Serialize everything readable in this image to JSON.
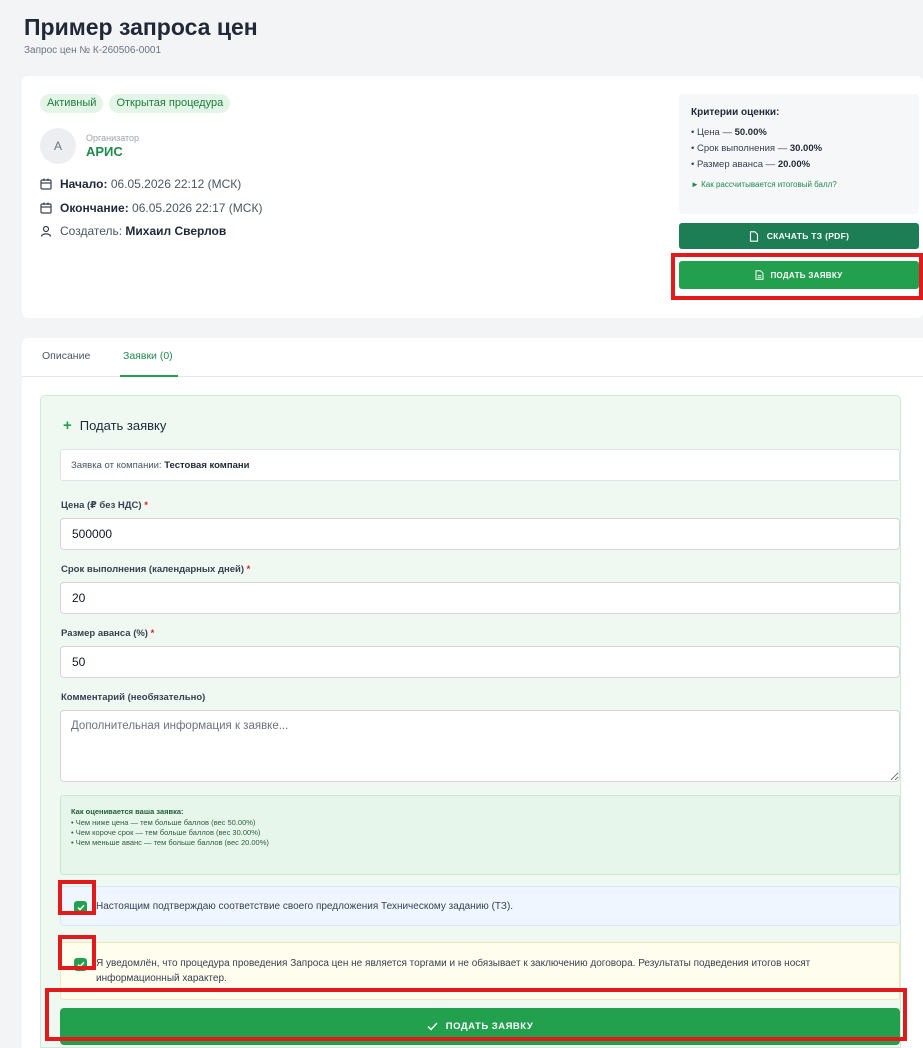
{
  "page": {
    "title": "Пример запроса цен",
    "subtitle": "Запрос цен № К-260506-0001"
  },
  "summary": {
    "badges": [
      "Активный",
      "Открытая процедура"
    ],
    "organizer": {
      "avatar_letter": "А",
      "label": "Организатор",
      "name": "АРИС"
    },
    "start": {
      "label": "Начало:",
      "value": " 06.05.2026 22:12 (МСК)"
    },
    "end": {
      "label": "Окончание:",
      "value": " 06.05.2026 22:17 (МСК)"
    },
    "creator": {
      "label": "Создатель: ",
      "value": "Михаил Сверлов"
    },
    "criteria": {
      "title": "Критерии оценки:",
      "items": [
        {
          "name": "• Цена — ",
          "value": "50.00%"
        },
        {
          "name": "• Срок выполнения — ",
          "value": "30.00%"
        },
        {
          "name": "• Размер аванса — ",
          "value": "20.00%"
        }
      ],
      "link": "► Как рассчитывается итоговый балл?"
    },
    "download_label": "СКАЧАТЬ ТЗ (PDF)",
    "submit_top_label": "ПОДАТЬ ЗАЯВКУ"
  },
  "tabs": [
    {
      "label": "Описание",
      "active": false
    },
    {
      "label": "Заявки (0)",
      "active": true
    }
  ],
  "form": {
    "title": "Подать заявку",
    "company_label": "Заявка от компании: ",
    "company_name": "Тестовая компани",
    "price": {
      "label": "Цена (₽ без НДС)",
      "required": " *",
      "value": "500000"
    },
    "duration": {
      "label": "Срок выполнения (календарных дней)",
      "required": " *",
      "value": "20"
    },
    "advance": {
      "label": "Размер аванса (%)",
      "required": " *",
      "value": "50"
    },
    "comment": {
      "label": "Комментарий (необязательно)",
      "placeholder": "Дополнительная информация к заявке...",
      "value": ""
    },
    "scoring": {
      "title": "Как оценивается ваша заявка:",
      "items": [
        "• Чем ниже цена — тем больше баллов (вес 50.00%)",
        "• Чем короче срок — тем больше баллов (вес 30.00%)",
        "• Чем меньше аванс — тем больше баллов (вес 20.00%)"
      ]
    },
    "confirm_tz": {
      "text": "Настоящим подтверждаю соответствие своего предложения Техническому заданию (ТЗ).",
      "checked": true
    },
    "confirm_notice": {
      "text": "Я уведомлён, что процедура проведения Запроса цен не является торгами и не обязывает к заключению договора. Результаты подведения итогов носят информационный характер.",
      "checked": true
    },
    "submit_label": "ПОДАТЬ ЗАЯВКУ"
  },
  "colors": {
    "primary_green": "#23a04d",
    "dark_green": "#1d7d55",
    "highlight_red": "#e11b1b",
    "form_background": "#eff9f1"
  },
  "icons": [
    "calendar-icon",
    "user-icon",
    "file-icon",
    "document-icon",
    "plus-icon",
    "checkmark-icon",
    "resize-handle-icon"
  ]
}
